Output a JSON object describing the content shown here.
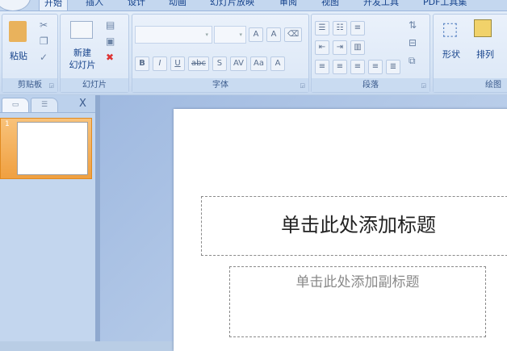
{
  "tabs": [
    "开始",
    "插入",
    "设计",
    "动画",
    "幻灯片放映",
    "审阅",
    "视图",
    "开发工具",
    "PDF工具集"
  ],
  "groups": {
    "clipboard": {
      "label": "剪贴板",
      "paste": "粘贴"
    },
    "slides": {
      "label": "幻灯片",
      "new_slide_1": "新建",
      "new_slide_2": "幻灯片"
    },
    "font": {
      "label": "字体",
      "font_name": "",
      "font_size": "",
      "bold": "B",
      "italic": "I",
      "underline": "U",
      "strike": "abc",
      "shadow": "S",
      "spacing": "AV",
      "case": "Aa",
      "color": "A",
      "grow": "A",
      "shrink": "A"
    },
    "paragraph": {
      "label": "段落"
    },
    "drawing": {
      "label": "绘图",
      "shapes": "形状",
      "arrange": "排列"
    }
  },
  "pane": {
    "close": "X",
    "slide_number": "1"
  },
  "slide": {
    "title_placeholder": "单击此处添加标题",
    "subtitle_placeholder": "单击此处添加副标题"
  }
}
